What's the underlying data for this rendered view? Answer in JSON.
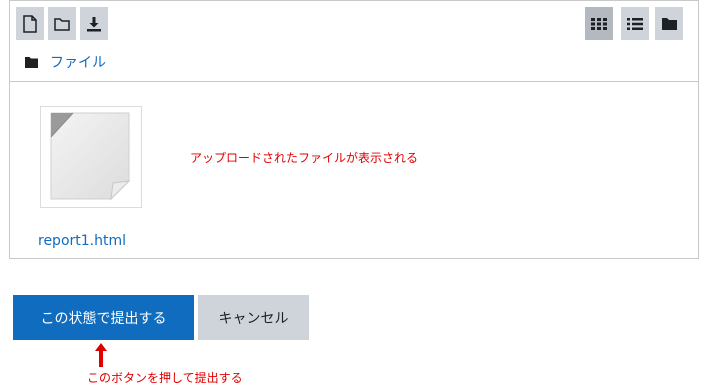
{
  "toolbar": {
    "left_buttons": [
      "new-file-icon",
      "new-folder-icon",
      "download-icon"
    ],
    "right_buttons": [
      "grid-view-icon",
      "list-view-icon",
      "folder-view-icon"
    ],
    "active_view": "grid-view-icon"
  },
  "path": {
    "label": "ファイル"
  },
  "files": [
    {
      "name": "report1.html",
      "icon": "file-thumbnail-icon"
    }
  ],
  "annotations": {
    "uploaded": "アップロードされたファイルが表示される",
    "press_button": "このボタンを押して提出する"
  },
  "buttons": {
    "submit": "この状態で提出する",
    "cancel": "キャンセル"
  },
  "colors": {
    "primary": "#0f6cbf",
    "secondary": "#ced4da",
    "annotation": "#e00000"
  }
}
